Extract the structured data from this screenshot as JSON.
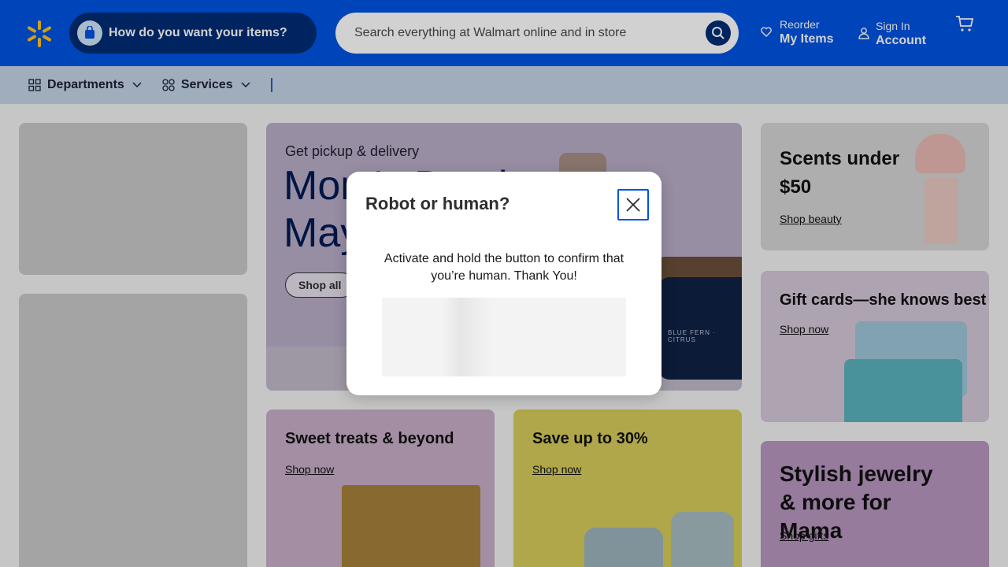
{
  "header": {
    "delivery_prompt": "How do you want your items?",
    "search_placeholder": "Search everything at Walmart online and in store",
    "reorder_small": "Reorder",
    "reorder_big": "My Items",
    "signin_small": "Sign In",
    "signin_big": "Account"
  },
  "nav": {
    "departments": "Departments",
    "services": "Services"
  },
  "hero": {
    "kicker": "Get pickup & delivery",
    "title": "Mom's Day in May",
    "cta": "Shop all",
    "product_label": "BLUE FERN · CITRUS"
  },
  "cards": {
    "scents": {
      "title": "Scents under $50",
      "link": "Shop beauty"
    },
    "gift": {
      "title": "Gift cards—she knows best",
      "link": "Shop now"
    },
    "jewelry": {
      "title": "Stylish jewelry & more for Mama",
      "link": "Shop gifts"
    },
    "sweet": {
      "title": "Sweet treats & beyond",
      "link": "Shop now"
    },
    "save": {
      "title": "Save up to 30%",
      "link": "Shop now"
    }
  },
  "modal": {
    "title": "Robot or human?",
    "message": "Activate and hold the button to confirm that you’re human. Thank You!"
  },
  "colors": {
    "brand_blue": "#0053e2",
    "brand_dark": "#002d74",
    "spark_yellow": "#ffc220"
  }
}
